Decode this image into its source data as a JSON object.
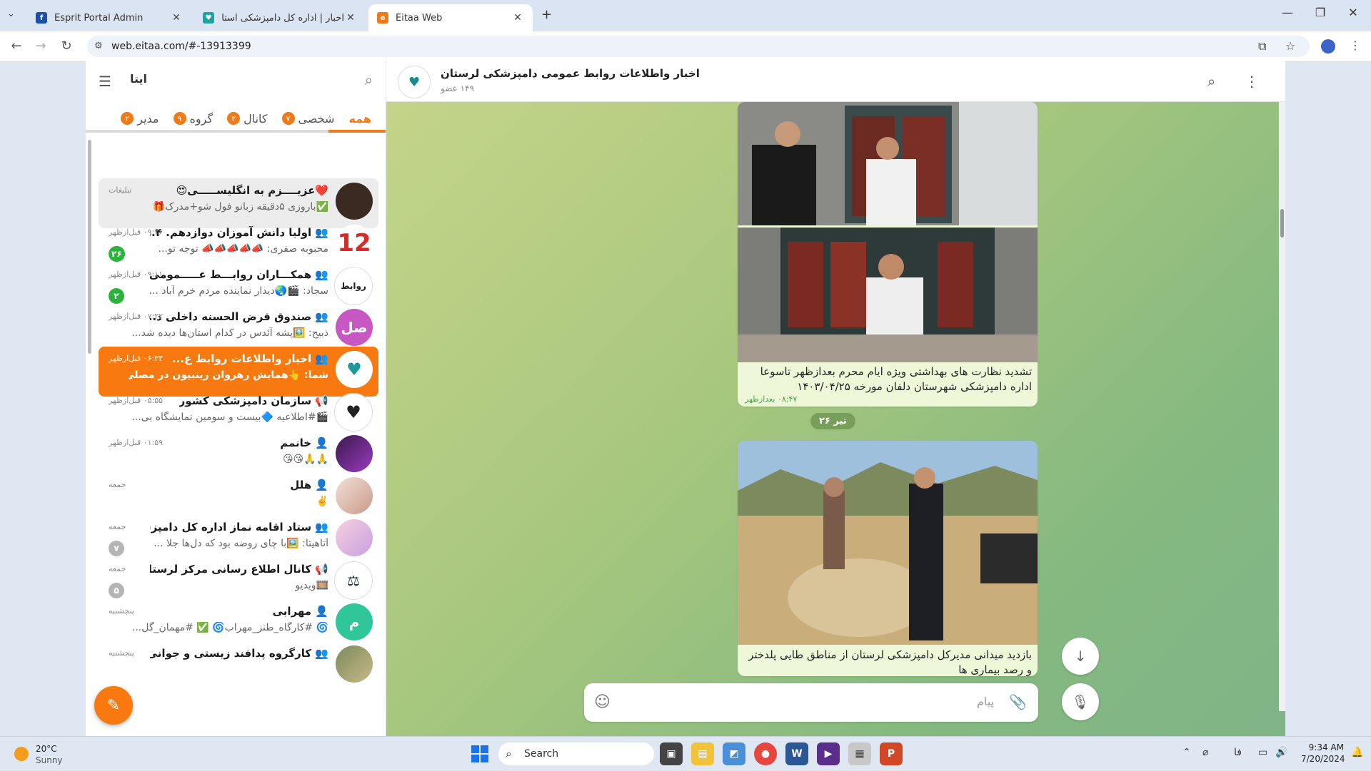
{
  "browser": {
    "tabs": [
      {
        "title": "Esprit Portal Admin",
        "icon": "esprit-favicon"
      },
      {
        "title": "اخبار | اداره کل دامپزشکی استان ل",
        "icon": "vet-favicon"
      },
      {
        "title": "Eitaa Web",
        "icon": "eitaa-favicon"
      }
    ],
    "url": "web.eitaa.com/#-13913399"
  },
  "app": {
    "brand": "ایتا",
    "filters": [
      {
        "label": "همه",
        "count": ""
      },
      {
        "label": "شخصی",
        "count": "۷"
      },
      {
        "label": "کانال",
        "count": "۳"
      },
      {
        "label": "گروه",
        "count": "۹"
      },
      {
        "label": "مدیر",
        "count": "۲"
      }
    ],
    "chats": [
      {
        "name": "❤️عزیــــزم به انگلیســـــی😍",
        "preview": "✅باروزی ۵دقیقه زبانو فول شو+مدرک🎁",
        "time": "تبلیغات",
        "badge": "",
        "avatar_text": "",
        "avatar_color": "#3a2a22"
      },
      {
        "name": "👥 اولیا دانش آموزان دوازدهم. ۴...",
        "preview": "محبوبه صفری: 📣📣📣📣📣 توجه تو...",
        "time": "۰۹:۲۶ قبل‌ازظهر",
        "badge": "۲۶",
        "avatar_text": "12",
        "avatar_color": "#d92a2a"
      },
      {
        "name": "👥 همکـــاران روابـــط عـــــمومی",
        "preview": "سجاد: 🎬🌏دیدار نماینده مردم خرم آباد ...",
        "time": "۰۹:۱۱ قبل‌ازظهر",
        "badge": "۲",
        "avatar_text": "روابط",
        "avatar_color": "#ffffff"
      },
      {
        "name": "👥 صندوق قرض الحسنه داخلی د...",
        "preview": "ذبیح: 🖼️پشه آئدس در کدام استان‌ها دیده شد...",
        "time": "۰۷:۲۲ قبل‌ازظهر",
        "badge": "",
        "avatar_text": "صل",
        "avatar_color": "#c758c2"
      },
      {
        "name": "👥 اخبار واطلاعات روابط ع...",
        "preview": "شما: 👆همایش رهروان زینبیون در مصلی الغدیر",
        "time": "۰۶:۳۳ قبل‌ازظهر",
        "badge": "",
        "avatar_text": "",
        "avatar_color": "#ffffff"
      },
      {
        "name": "📢 سازمان دامپزشکی کشور",
        "preview": "🎬#اطلاعیه 🔷بیست و سومین نمایشگاه بی...",
        "time": "۰۵:۵۵ قبل‌ازظهر",
        "badge": "",
        "avatar_text": "",
        "avatar_color": "#ffffff"
      },
      {
        "name": "👤 خانمم",
        "preview": "🙏🙏😘😘",
        "time": "۰۱:۵۹ قبل‌ازظهر",
        "badge": "",
        "avatar_text": "",
        "avatar_color": "#5a2a6a"
      },
      {
        "name": "👤 هلل",
        "preview": "✌️",
        "time": "جمعه",
        "badge": "",
        "avatar_text": "",
        "avatar_color": "#e9c9c0"
      },
      {
        "name": "👥 ستاد اقامه نماز اداره کل دامپزشکی",
        "preview": "آتاهیتا: 🖼️با چای روضه بود که دل‌ها جلا ...",
        "time": "جمعه",
        "badge": "۷",
        "avatar_text": "",
        "avatar_color": "#e8b9d0"
      },
      {
        "name": "📢 کانال اطلاع رسانی مرکز لرستان",
        "preview": "🎞️ویدیو",
        "time": "جمعه",
        "badge": "۵",
        "avatar_text": "",
        "avatar_color": "#ffffff"
      },
      {
        "name": "👤 مهرابی",
        "preview": "🌀 #کارگاه_طنز_مهراب🌀 ✅ #مهمان_گل...",
        "time": "پنجشنبه",
        "badge": "",
        "avatar_text": "م",
        "avatar_color": "#2fc79a"
      },
      {
        "name": "👥 کارگروه پدافند زیستی و جوانی جمع...",
        "preview": "",
        "time": "پنجشنبه",
        "badge": "",
        "avatar_text": "",
        "avatar_color": "#7a8a5a"
      }
    ],
    "conversation": {
      "title": "اخبار واطلاعات روابط عمومی دامپزشکی لرستان",
      "members": "۱۴۹ عضو",
      "message1": {
        "caption": "تشدید نظارت های بهداشتی ویژه ایام محرم بعدازظهر تاسوعا اداره دامپزشکی شهرستان دلفان مورخه ۱۴۰۳/۰۴/۲۵",
        "time": "۰۸:۴۷ بعدازظهر"
      },
      "date_separator": "۲۶ تیر",
      "message2": {
        "caption": "بازدید میدانی مدیرکل دامپزشکی لرستان از مناطق طایی پلدختر و رصد بیماری ها"
      },
      "composer_placeholder": "پیام"
    }
  },
  "taskbar": {
    "temp": "20°C",
    "condition": "Sunny",
    "search": "Search",
    "lang": "فا",
    "time": "9:34 AM",
    "date": "7/20/2024"
  }
}
